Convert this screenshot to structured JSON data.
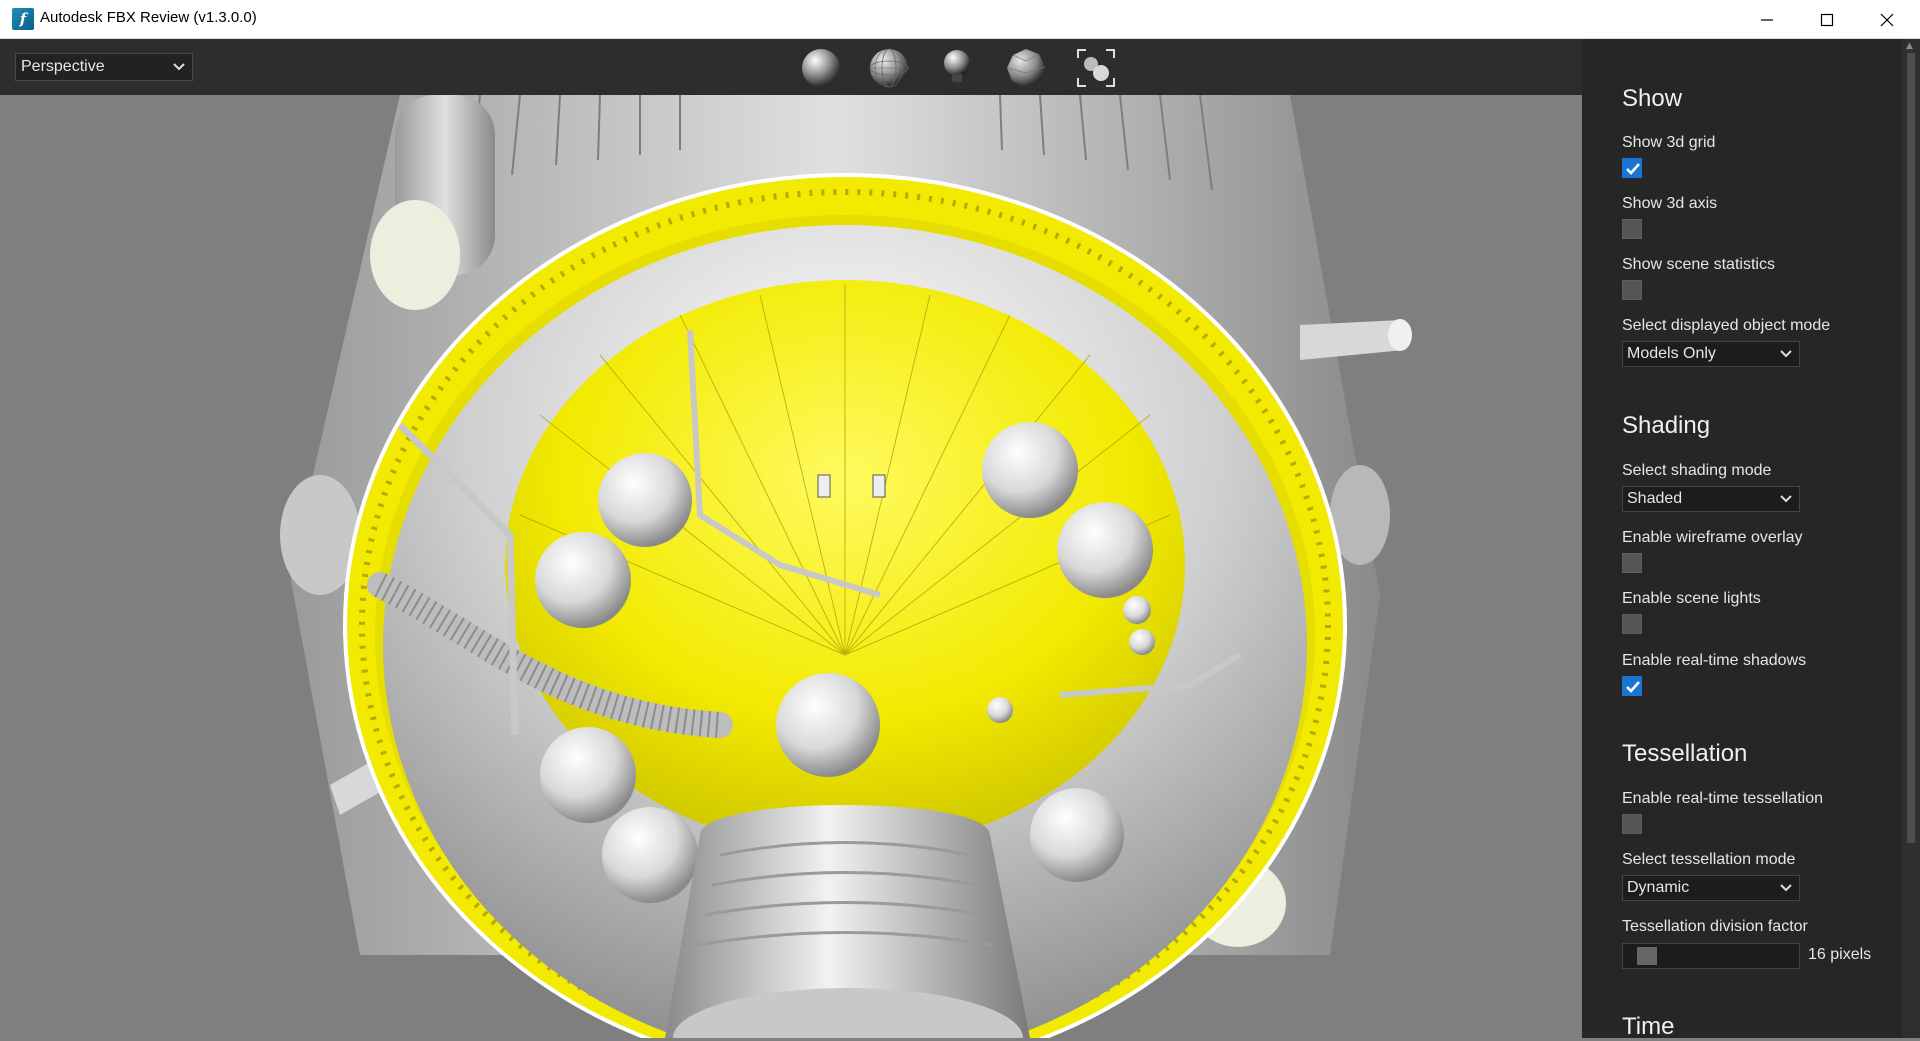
{
  "window": {
    "title": "Autodesk FBX Review (v1.3.0.0)",
    "icon": "fbx-app-icon",
    "controls": [
      "minimize-icon",
      "maximize-icon",
      "close-icon"
    ]
  },
  "viewport_toolbar": {
    "camera_view": "Perspective",
    "tools": [
      "shaded-sphere-icon",
      "wireframe-sphere-icon",
      "light-bulb-icon",
      "faceted-sphere-icon",
      "frame-selection-icon"
    ]
  },
  "panel": {
    "show": {
      "heading": "Show",
      "show_grid_label": "Show 3d grid",
      "show_grid": true,
      "show_axis_label": "Show 3d axis",
      "show_axis": false,
      "show_stats_label": "Show scene statistics",
      "show_stats": false,
      "object_mode_label": "Select displayed object mode",
      "object_mode": "Models Only"
    },
    "shading": {
      "heading": "Shading",
      "mode_label": "Select shading mode",
      "mode": "Shaded",
      "wireframe_label": "Enable wireframe overlay",
      "wireframe": false,
      "lights_label": "Enable scene lights",
      "lights": false,
      "shadows_label": "Enable real-time shadows",
      "shadows": true
    },
    "tessellation": {
      "heading": "Tessellation",
      "realtime_label": "Enable real-time tessellation",
      "realtime": false,
      "mode_label": "Select tessellation mode",
      "mode": "Dynamic",
      "division_label": "Tessellation division factor",
      "division_value": "16 pixels"
    },
    "time": {
      "heading": "Time"
    }
  },
  "colors": {
    "accent_checkbox": "#1a74d2",
    "model_yellow": "#f2ea00",
    "model_gray": "#d6d6d6"
  }
}
